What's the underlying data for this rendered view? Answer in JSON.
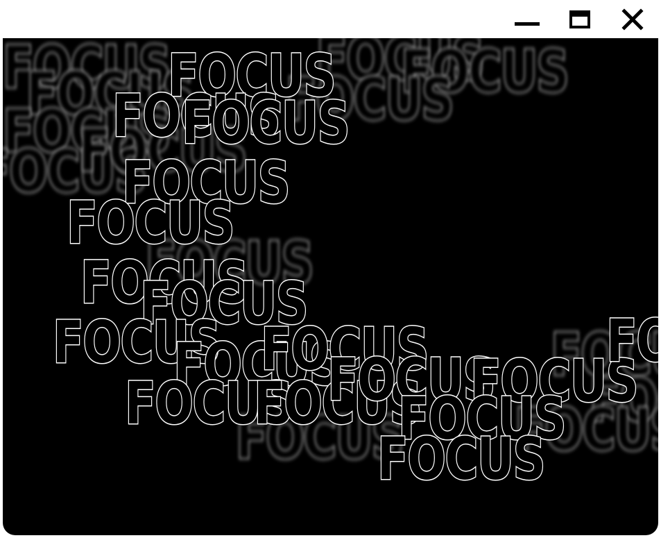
{
  "window": {
    "controls": {
      "minimize_icon": "minimize-icon",
      "maximize_icon": "maximize-icon",
      "close_icon": "close-icon"
    }
  },
  "canvas": {
    "background": "#000000",
    "outline_color": "#ffffff",
    "word": "FOCUS",
    "words": [
      {
        "text": "FOCUS",
        "state": "blurred"
      },
      {
        "text": "FOCUS",
        "state": "blurred"
      },
      {
        "text": "FOCUS",
        "state": "blurred"
      },
      {
        "text": "FOCUS",
        "state": "blurred"
      },
      {
        "text": "FOCUS",
        "state": "blurred"
      },
      {
        "text": "FOCUS",
        "state": "blurred"
      },
      {
        "text": "FOCUS",
        "state": "blurred"
      },
      {
        "text": "FOCUS",
        "state": "blurred"
      },
      {
        "text": "FOCUS",
        "state": "blurred"
      },
      {
        "text": "FOCUS",
        "state": "blurred"
      },
      {
        "text": "FOCUS",
        "state": "blurred"
      },
      {
        "text": "FOCUS",
        "state": "blurred"
      },
      {
        "text": "FOCUS",
        "state": "blurred"
      },
      {
        "text": "FOCUS",
        "state": "sharp"
      },
      {
        "text": "FOCUS",
        "state": "sharp"
      },
      {
        "text": "FOCUS",
        "state": "sharp"
      },
      {
        "text": "FOCUS",
        "state": "sharp"
      },
      {
        "text": "FOCUS",
        "state": "sharp"
      },
      {
        "text": "FOCUS",
        "state": "sharp"
      },
      {
        "text": "FOCUS",
        "state": "sharp"
      },
      {
        "text": "FOCUS",
        "state": "sharp"
      },
      {
        "text": "FOCUS",
        "state": "sharp"
      },
      {
        "text": "FOCUS",
        "state": "sharp"
      },
      {
        "text": "FOCUS",
        "state": "sharp"
      },
      {
        "text": "FOCUS",
        "state": "sharp"
      },
      {
        "text": "FOCUS",
        "state": "sharp"
      },
      {
        "text": "FOCUS",
        "state": "sharp"
      },
      {
        "text": "FOCUS",
        "state": "sharp"
      },
      {
        "text": "FOCUS",
        "state": "sharp"
      },
      {
        "text": "FOCUS",
        "state": "sharp"
      }
    ]
  }
}
